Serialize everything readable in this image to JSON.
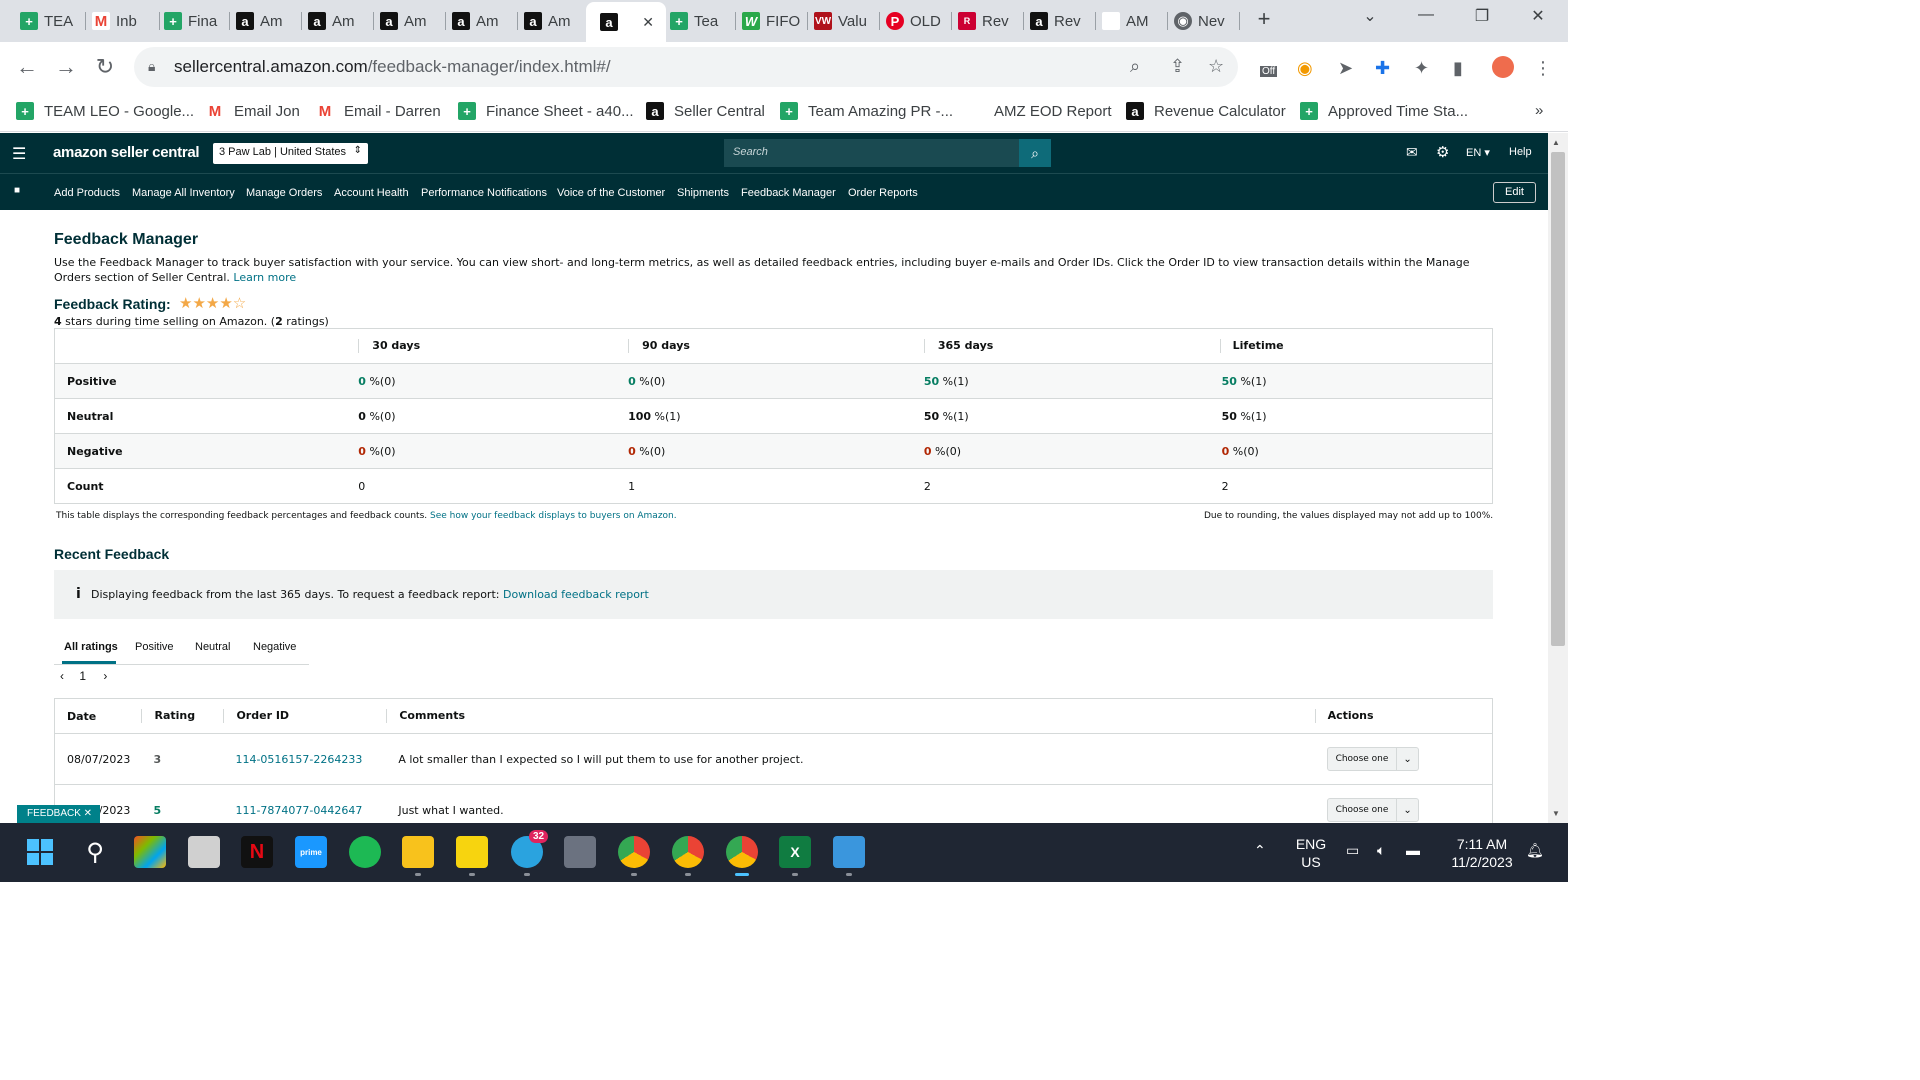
{
  "browser": {
    "tabs": [
      {
        "label": "TEA",
        "icon": "sheets-icon",
        "glyph": "+"
      },
      {
        "label": "Inb",
        "icon": "gmail-icon",
        "glyph": "M"
      },
      {
        "label": "Fina",
        "icon": "sheets-icon",
        "glyph": "+"
      },
      {
        "label": "Am",
        "icon": "amazon-icon",
        "glyph": "a"
      },
      {
        "label": "Am",
        "icon": "amazon-icon",
        "glyph": "a"
      },
      {
        "label": "Am",
        "icon": "amazon-icon",
        "glyph": "a"
      },
      {
        "label": "Am",
        "icon": "amazon-icon",
        "glyph": "a"
      },
      {
        "label": "Am",
        "icon": "amazon-icon",
        "glyph": "a"
      },
      {
        "label": "",
        "icon": "amazon-icon",
        "glyph": "a",
        "active": true
      },
      {
        "label": "Tea",
        "icon": "sheets-icon",
        "glyph": "+"
      },
      {
        "label": "FIFO",
        "icon": "w-icon",
        "glyph": "W"
      },
      {
        "label": "Valu",
        "icon": "vw-icon",
        "glyph": "VW"
      },
      {
        "label": "OLD",
        "icon": "pinterest-icon",
        "glyph": "P"
      },
      {
        "label": "Rev",
        "icon": "rx-icon",
        "glyph": "R"
      },
      {
        "label": "Rev",
        "icon": "amazon-icon",
        "glyph": "a"
      },
      {
        "label": "AM",
        "icon": "eod-icon",
        "glyph": "✎"
      },
      {
        "label": "Nev",
        "icon": "chrome-icon",
        "glyph": "◉"
      }
    ],
    "close_glyph": "✕",
    "new_tab_glyph": "+",
    "url_host": "sellercentral.amazon.com",
    "url_path": "/feedback-manager/index.html#/",
    "bookmarks": [
      {
        "label": "TEAM LEO - Google...",
        "icon": "sheets-icon",
        "glyph": "+"
      },
      {
        "label": "Email Jon",
        "icon": "gmail-icon",
        "glyph": "M"
      },
      {
        "label": "Email - Darren",
        "icon": "gmail-icon",
        "glyph": "M"
      },
      {
        "label": "Finance Sheet - a40...",
        "icon": "sheets-icon",
        "glyph": "+"
      },
      {
        "label": "Seller Central",
        "icon": "amazon-icon",
        "glyph": "a"
      },
      {
        "label": "Team Amazing PR -...",
        "icon": "sheets-icon",
        "glyph": "+"
      },
      {
        "label": "AMZ EOD Report",
        "icon": "eod-icon",
        "glyph": "✎"
      },
      {
        "label": "Revenue Calculator",
        "icon": "amazon-icon",
        "glyph": "a"
      },
      {
        "label": "Approved Time Sta...",
        "icon": "sheets-icon",
        "glyph": "+"
      }
    ],
    "bookmarks_more": "»",
    "ext_badge": "Off"
  },
  "header": {
    "logo": "amazon seller central",
    "store": "3 Paw Lab | United States",
    "search_placeholder": "Search",
    "lang": "EN",
    "help": "Help",
    "edit": "Edit",
    "nav": [
      "Add Products",
      "Manage All Inventory",
      "Manage Orders",
      "Account Health",
      "Performance Notifications",
      "Voice of the Customer",
      "Shipments",
      "Feedback Manager",
      "Order Reports"
    ]
  },
  "page": {
    "title": "Feedback Manager",
    "description": "Use the Feedback Manager to track buyer satisfaction with your service. You can view short- and long-term metrics, as well as detailed feedback entries, including buyer e-mails and Order IDs. Click the Order ID to view transaction details within the Manage Orders section of Seller Central.",
    "learn_more": "Learn more",
    "rating_label": "Feedback Rating:",
    "rating_stars": "★★★★☆",
    "rating_value": "4",
    "rating_sub_mid": " stars during time selling on Amazon. (",
    "rating_count": "2",
    "rating_sub_end": " ratings)"
  },
  "metrics": {
    "headers": [
      "30 days",
      "90 days",
      "365 days",
      "Lifetime"
    ],
    "rows": [
      {
        "label": "Positive",
        "kind": "pos",
        "cells": [
          {
            "n": "0",
            "s": " %(0)"
          },
          {
            "n": "0",
            "s": " %(0)"
          },
          {
            "n": "50",
            "s": " %(1)"
          },
          {
            "n": "50",
            "s": " %(1)"
          }
        ]
      },
      {
        "label": "Neutral",
        "kind": "plain",
        "cells": [
          {
            "n": "0",
            "s": " %(0)"
          },
          {
            "n": "100",
            "s": " %(1)"
          },
          {
            "n": "50",
            "s": " %(1)"
          },
          {
            "n": "50",
            "s": " %(1)"
          }
        ]
      },
      {
        "label": "Negative",
        "kind": "neg",
        "cells": [
          {
            "n": "0",
            "s": " %(0)"
          },
          {
            "n": "0",
            "s": " %(0)"
          },
          {
            "n": "0",
            "s": " %(0)"
          },
          {
            "n": "0",
            "s": " %(0)"
          }
        ]
      },
      {
        "label": "Count",
        "kind": "count",
        "cells": [
          {
            "n": "0",
            "s": ""
          },
          {
            "n": "1",
            "s": ""
          },
          {
            "n": "2",
            "s": ""
          },
          {
            "n": "2",
            "s": ""
          }
        ]
      }
    ],
    "note_left": "This table displays the corresponding feedback percentages and feedback counts.",
    "note_link": "See how your feedback displays to buyers on Amazon.",
    "note_right": "Due to rounding, the values displayed may not add up to 100%."
  },
  "recent": {
    "title": "Recent Feedback",
    "info_icon": "i",
    "info_text": "Displaying feedback from the last 365 days. To request a feedback report:",
    "info_link": "Download feedback report",
    "tabs": [
      "All ratings",
      "Positive",
      "Neutral",
      "Negative"
    ],
    "page": "1",
    "prev": "‹",
    "next": "›",
    "columns": [
      "Date",
      "Rating",
      "Order ID",
      "Comments",
      "Actions"
    ],
    "rows": [
      {
        "date": "08/07/2023",
        "rating": "3",
        "order": "114-0516157-2264233",
        "comment": "A lot smaller than I expected so I will put them to use for another project.",
        "action": "Choose one"
      },
      {
        "date": "07/15/2023",
        "rating": "5",
        "order": "111-7874077-0442647",
        "comment": "Just what I wanted.",
        "action": "Choose one"
      }
    ],
    "feedback_tab": "FEEDBACK ✕"
  },
  "taskbar": {
    "lang_top": "ENG",
    "lang_bottom": "US",
    "time": "7:11 AM",
    "date": "11/2/2023",
    "telegram_badge": "32"
  }
}
